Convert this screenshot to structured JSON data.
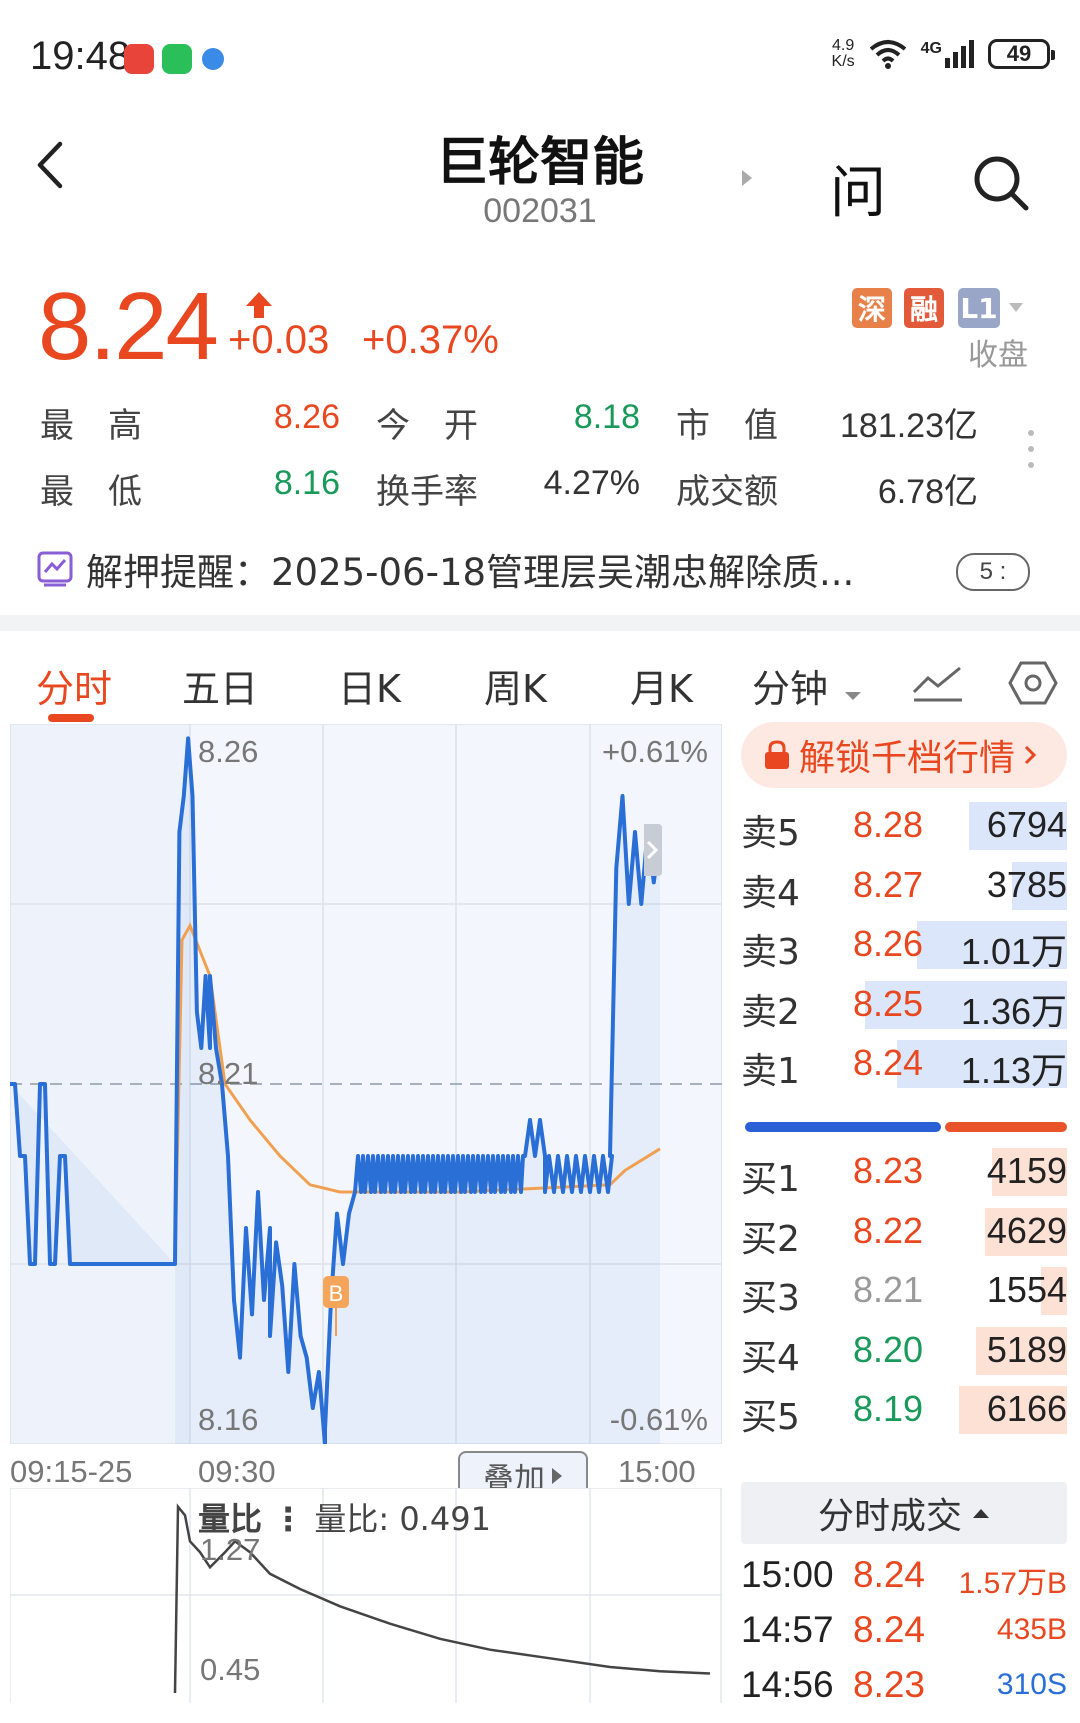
{
  "status_bar": {
    "time": "19:48",
    "net_speed_top": "4.9",
    "net_speed_bottom": "K/s",
    "network": "4G",
    "battery": "49"
  },
  "header": {
    "name": "巨轮智能",
    "code": "002031",
    "ask_label": "问"
  },
  "quote": {
    "price": "8.24",
    "change": "+0.03",
    "change_pct": "+0.37%",
    "tags": [
      "深",
      "融",
      "L1"
    ],
    "market_status": "收盘",
    "stats": [
      {
        "label": "最　高",
        "value": "8.26",
        "color": "red"
      },
      {
        "label": "今　开",
        "value": "8.18",
        "color": "green"
      },
      {
        "label": "市　值",
        "value": "181.23亿",
        "color": "dark"
      },
      {
        "label": "最　低",
        "value": "8.16",
        "color": "green"
      },
      {
        "label": "换手率",
        "value": "4.27%",
        "color": "dark"
      },
      {
        "label": "成交额",
        "value": "6.78亿",
        "color": "dark"
      }
    ]
  },
  "notice": {
    "text": "解押提醒：2025-06-18管理层吴潮忠解除质...",
    "badge": "5 :"
  },
  "tabs": [
    "分时",
    "五日",
    "日K",
    "周K",
    "月K",
    "分钟"
  ],
  "chart": {
    "price_high": "8.26",
    "price_mid": "8.21",
    "price_low": "8.16",
    "pct_high": "+0.61%",
    "pct_low": "-0.61%",
    "time_start": "09:15-25",
    "time_open": "09:30",
    "time_close": "15:00",
    "overlay_label": "叠加",
    "marker": "B",
    "volume_title": "量比",
    "volume_value": "量比:  0.491",
    "vol_high": "1.27",
    "vol_low": "0.45"
  },
  "order_book": {
    "unlock_label": "解锁千档行情",
    "asks": [
      {
        "name": "卖5",
        "price": "8.28",
        "vol": "6794",
        "color": "red",
        "fill": 0.3
      },
      {
        "name": "卖4",
        "price": "8.27",
        "vol": "3785",
        "color": "red",
        "fill": 0.17
      },
      {
        "name": "卖3",
        "price": "8.26",
        "vol": "1.01万",
        "color": "red",
        "fill": 0.46
      },
      {
        "name": "卖2",
        "price": "8.25",
        "vol": "1.36万",
        "color": "red",
        "fill": 0.62
      },
      {
        "name": "卖1",
        "price": "8.24",
        "vol": "1.13万",
        "color": "red",
        "fill": 0.52
      }
    ],
    "bids": [
      {
        "name": "买1",
        "price": "8.23",
        "vol": "4159",
        "color": "red",
        "fill": 0.23
      },
      {
        "name": "买2",
        "price": "8.22",
        "vol": "4629",
        "color": "red",
        "fill": 0.25
      },
      {
        "name": "买3",
        "price": "8.21",
        "vol": "1554",
        "color": "gray",
        "fill": 0.08
      },
      {
        "name": "买4",
        "price": "8.20",
        "vol": "5189",
        "color": "green",
        "fill": 0.28
      },
      {
        "name": "买5",
        "price": "8.19",
        "vol": "6166",
        "color": "green",
        "fill": 0.33
      }
    ],
    "buy_ratio": 0.61
  },
  "trades": {
    "title": "分时成交",
    "rows": [
      {
        "time": "15:00",
        "price": "8.24",
        "vol": "1.57万B",
        "vcolor": "red"
      },
      {
        "time": "14:57",
        "price": "8.24",
        "vol": "435B",
        "vcolor": "red"
      },
      {
        "time": "14:56",
        "price": "8.23",
        "vol": "310S",
        "vcolor": "blue"
      }
    ]
  },
  "colors": {
    "accent": "#e8471f",
    "up": "#e8471f",
    "down": "#1a9a5a",
    "line": "#2a6fd6",
    "avg": "#f0a050"
  }
}
